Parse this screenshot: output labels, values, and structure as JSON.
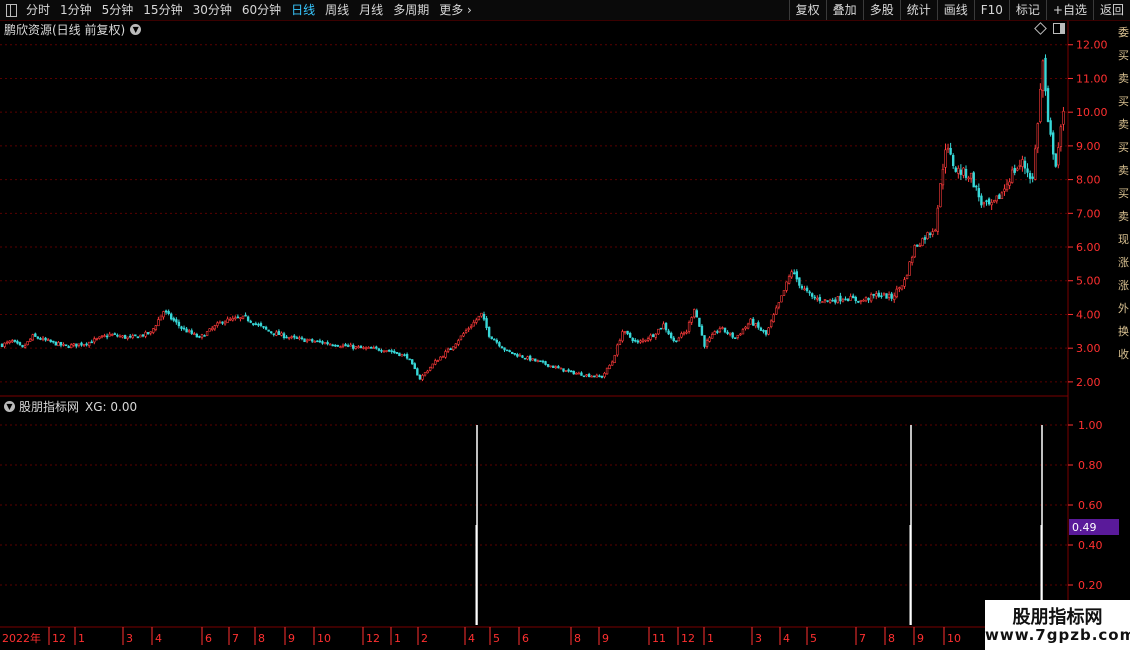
{
  "toolbar": {
    "periods": [
      "分时",
      "1分钟",
      "5分钟",
      "15分钟",
      "30分钟",
      "60分钟",
      "日线",
      "周线",
      "月线",
      "多周期",
      "更多"
    ],
    "active": "日线",
    "right": [
      "复权",
      "叠加",
      "多股",
      "统计",
      "画线",
      "F10",
      "标记",
      "+自选",
      "返回"
    ]
  },
  "chart": {
    "title": "鹏欣资源(日线 前复权)",
    "price_axis": [
      "12.00",
      "11.00",
      "10.00",
      "9.00",
      "8.00",
      "7.00",
      "6.00",
      "5.00",
      "4.00",
      "3.00",
      "2.00"
    ],
    "colors": {
      "up": "#ff3b3b",
      "down": "#38d8d8",
      "axis": "#ff3030",
      "grid": "#5a0000"
    }
  },
  "indicator": {
    "name": "股朋指标网",
    "xg_label": "XG: 0.00",
    "axis_labels": [
      "1.00",
      "0.80",
      "0.60",
      "0.40",
      "0.20"
    ],
    "current_value": "0.49",
    "value_badge_color": "#5a1a9a",
    "signal_color": "#ffffff"
  },
  "time_axis": {
    "labels": [
      "2022年",
      "12",
      "1",
      "3",
      "4",
      "6",
      "7",
      "8",
      "9",
      "10",
      "12",
      "1",
      "2",
      "4",
      "5",
      "6",
      "8",
      "9",
      "11",
      "12",
      "1",
      "3",
      "4",
      "5",
      "7",
      "8",
      "9",
      "10"
    ]
  },
  "side_labels": [
    "委",
    "买",
    "卖",
    "买",
    "卖",
    "买",
    "卖",
    "买",
    "卖",
    "现",
    "涨",
    "涨",
    "外",
    "换",
    "收"
  ],
  "watermark": {
    "cn": "股朋指标网",
    "url": "www.7gpzb.com"
  },
  "chart_data": {
    "type": "candlestick",
    "title": "鹏欣资源(日线 前复权)",
    "ylim": [
      1.7,
      12.2
    ],
    "price_path": [
      [
        0,
        3.1
      ],
      [
        4,
        3.2
      ],
      [
        8,
        3.0
      ],
      [
        12,
        3.35
      ],
      [
        18,
        3.2
      ],
      [
        25,
        3.05
      ],
      [
        33,
        3.15
      ],
      [
        42,
        3.4
      ],
      [
        50,
        3.3
      ],
      [
        58,
        3.45
      ],
      [
        63,
        4.1
      ],
      [
        70,
        3.6
      ],
      [
        77,
        3.3
      ],
      [
        86,
        3.8
      ],
      [
        95,
        3.9
      ],
      [
        104,
        3.5
      ],
      [
        113,
        3.3
      ],
      [
        122,
        3.2
      ],
      [
        131,
        3.1
      ],
      [
        140,
        3.0
      ],
      [
        150,
        2.95
      ],
      [
        158,
        2.75
      ],
      [
        163,
        2.1
      ],
      [
        169,
        2.6
      ],
      [
        175,
        3.0
      ],
      [
        182,
        3.6
      ],
      [
        187,
        4.0
      ],
      [
        190,
        3.4
      ],
      [
        197,
        2.9
      ],
      [
        205,
        2.7
      ],
      [
        213,
        2.5
      ],
      [
        221,
        2.3
      ],
      [
        228,
        2.2
      ],
      [
        234,
        2.15
      ],
      [
        238,
        2.6
      ],
      [
        242,
        3.5
      ],
      [
        248,
        3.15
      ],
      [
        254,
        3.4
      ],
      [
        258,
        3.7
      ],
      [
        262,
        3.2
      ],
      [
        267,
        3.5
      ],
      [
        270,
        4.2
      ],
      [
        274,
        3.1
      ],
      [
        280,
        3.6
      ],
      [
        286,
        3.3
      ],
      [
        292,
        3.8
      ],
      [
        298,
        3.4
      ],
      [
        304,
        4.5
      ],
      [
        308,
        5.3
      ],
      [
        312,
        4.8
      ],
      [
        316,
        4.5
      ],
      [
        322,
        4.4
      ],
      [
        329,
        4.5
      ],
      [
        335,
        4.4
      ],
      [
        342,
        4.6
      ],
      [
        347,
        4.5
      ],
      [
        352,
        5.0
      ],
      [
        356,
        6.0
      ],
      [
        360,
        6.3
      ],
      [
        364,
        6.6
      ],
      [
        368,
        9.0
      ],
      [
        372,
        8.3
      ],
      [
        378,
        8.1
      ],
      [
        382,
        7.3
      ],
      [
        386,
        7.2
      ],
      [
        390,
        7.6
      ],
      [
        394,
        8.2
      ],
      [
        398,
        8.5
      ],
      [
        402,
        8.0
      ],
      [
        406,
        11.5
      ],
      [
        408,
        9.6
      ],
      [
        411,
        8.5
      ],
      [
        414,
        9.9
      ]
    ],
    "indicator_signals": [
      {
        "x_label": "4",
        "value": 1.0
      },
      {
        "x_label": "9",
        "value": 1.0
      },
      {
        "x_label": "10",
        "value": 1.0
      }
    ],
    "indicator_ylim": [
      0,
      1.05
    ]
  }
}
